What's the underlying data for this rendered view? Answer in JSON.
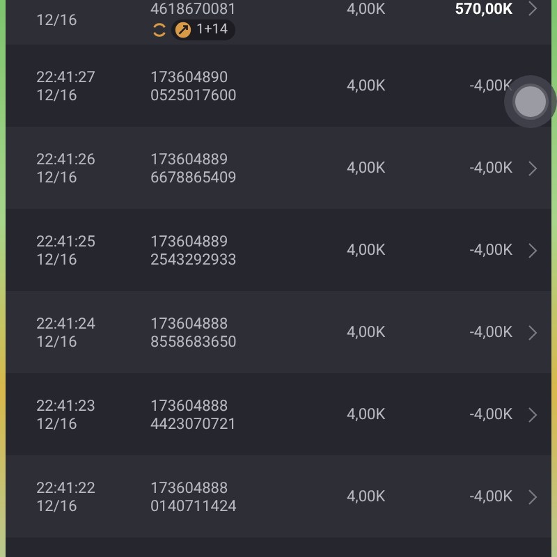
{
  "rows": [
    {
      "kind": "win",
      "date": "12/16",
      "id_lines": [
        "4618670081"
      ],
      "bet": "4,00K",
      "amount": "570,00K",
      "badge": {
        "text": "1+14"
      },
      "chevron": true
    },
    {
      "kind": "loss",
      "time": "22:41:27",
      "date": "12/16",
      "id_lines": [
        "173604890",
        "0525017600"
      ],
      "bet": "4,00K",
      "amount": "-4,00K",
      "chevron": false
    },
    {
      "kind": "loss",
      "time": "22:41:26",
      "date": "12/16",
      "id_lines": [
        "173604889",
        "6678865409"
      ],
      "bet": "4,00K",
      "amount": "-4,00K",
      "chevron": true
    },
    {
      "kind": "loss",
      "time": "22:41:25",
      "date": "12/16",
      "id_lines": [
        "173604889",
        "2543292933"
      ],
      "bet": "4,00K",
      "amount": "-4,00K",
      "chevron": true
    },
    {
      "kind": "loss",
      "time": "22:41:24",
      "date": "12/16",
      "id_lines": [
        "173604888",
        "8558683650"
      ],
      "bet": "4,00K",
      "amount": "-4,00K",
      "chevron": true
    },
    {
      "kind": "loss",
      "time": "22:41:23",
      "date": "12/16",
      "id_lines": [
        "173604888",
        "4423070721"
      ],
      "bet": "4,00K",
      "amount": "-4,00K",
      "chevron": true
    },
    {
      "kind": "loss",
      "time": "22:41:22",
      "date": "12/16",
      "id_lines": [
        "173604888",
        "0140711424"
      ],
      "bet": "4,00K",
      "amount": "-4,00K",
      "chevron": true
    }
  ]
}
